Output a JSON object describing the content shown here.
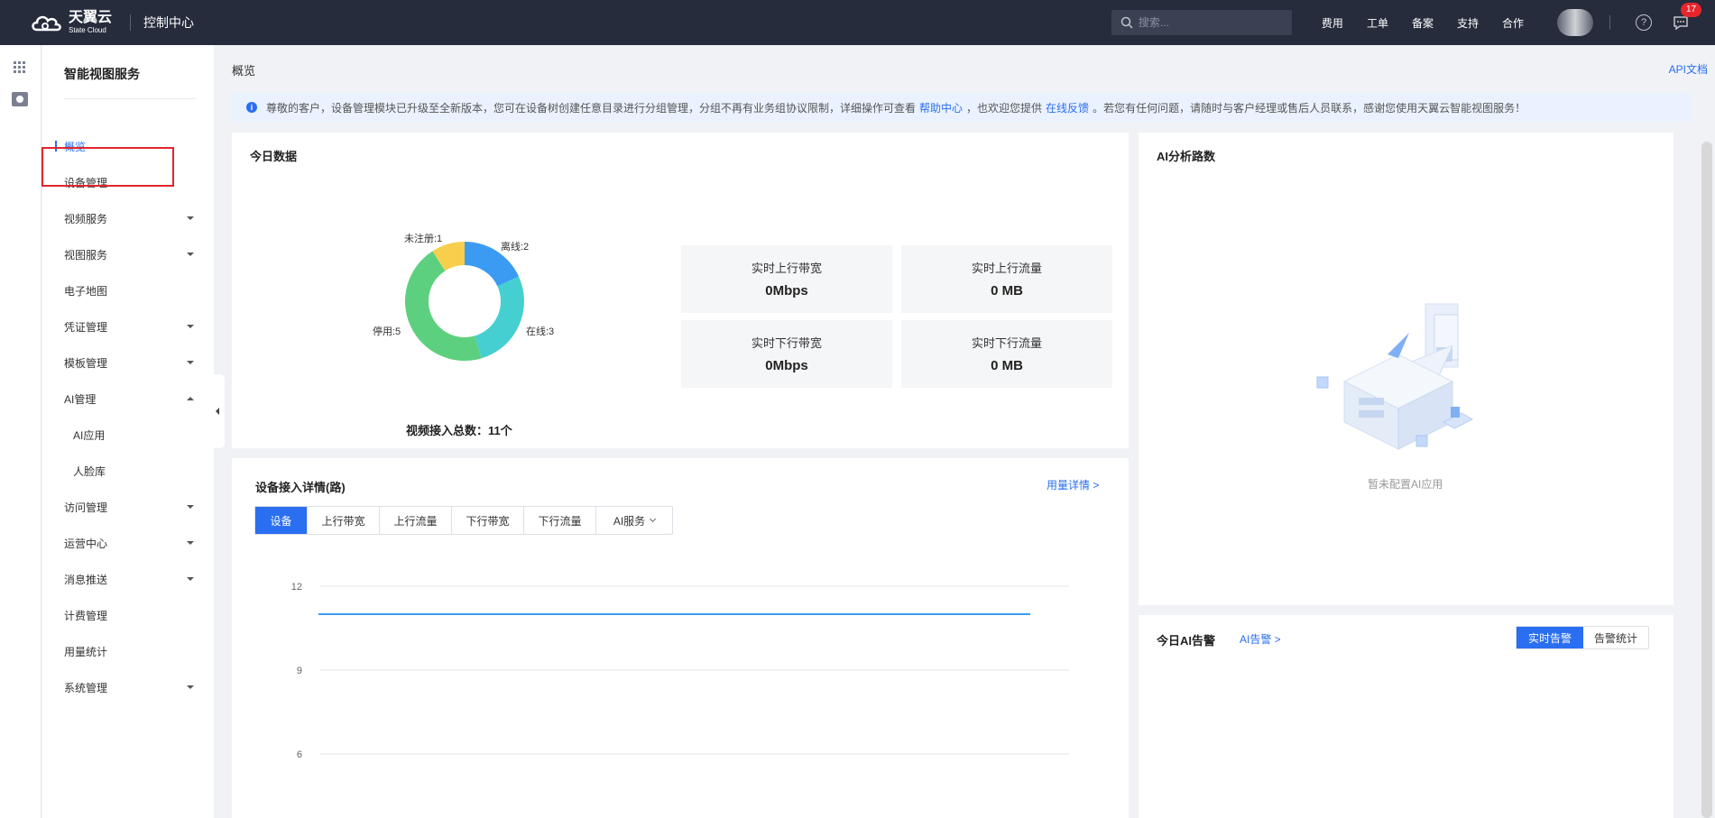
{
  "topbar": {
    "brand_cn": "天翼云",
    "brand_en": "State Cloud",
    "console": "控制中心",
    "search_placeholder": "搜索...",
    "links": [
      "费用",
      "工单",
      "备案",
      "支持",
      "合作"
    ],
    "help_glyph": "?",
    "message_count": "17"
  },
  "sidebar": {
    "title": "智能视图服务",
    "items": [
      {
        "label": "概览"
      },
      {
        "label": "设备管理"
      },
      {
        "label": "视频服务"
      },
      {
        "label": "视图服务"
      },
      {
        "label": "电子地图"
      },
      {
        "label": "凭证管理"
      },
      {
        "label": "模板管理"
      },
      {
        "label": "AI管理"
      },
      {
        "label": "AI应用"
      },
      {
        "label": "人脸库"
      },
      {
        "label": "访问管理"
      },
      {
        "label": "运营中心"
      },
      {
        "label": "消息推送"
      },
      {
        "label": "计费管理"
      },
      {
        "label": "用量统计"
      },
      {
        "label": "系统管理"
      }
    ]
  },
  "main": {
    "breadcrumb": "概览",
    "api_doc": "API文档",
    "notice": {
      "text1": "尊敬的客户，设备管理模块已升级至全新版本，您可在设备树创建任意目录进行分组管理，分组不再有业务组协议限制，详细操作可查看",
      "link1": "帮助中心",
      "text2": "，也欢迎您提供",
      "link2": "在线反馈",
      "text3": "。若您有任何问题，请随时与客户经理或售后人员联系，感谢您使用天翼云智能视图服务！"
    },
    "today": {
      "title": "今日数据",
      "pie_labels": [
        "未注册:1",
        "离线:2",
        "在线:3",
        "停用:5"
      ],
      "total": "视频接入总数：11个",
      "stats": [
        {
          "label": "实时上行带宽",
          "value": "0Mbps"
        },
        {
          "label": "实时上行流量",
          "value": "0 MB"
        },
        {
          "label": "实时下行带宽",
          "value": "0Mbps"
        },
        {
          "label": "实时下行流量",
          "value": "0 MB"
        }
      ]
    },
    "detail": {
      "title": "设备接入详情(路)",
      "usage_link": "用量详情 >",
      "tabs": [
        "设备",
        "上行带宽",
        "上行流量",
        "下行带宽",
        "下行流量",
        "AI服务"
      ]
    },
    "ai": {
      "title": "AI分析路数",
      "empty": "暂未配置AI应用"
    },
    "alerts": {
      "title": "今日AI告警",
      "link": "AI告警 >",
      "btn_realtime": "实时告警",
      "btn_stats": "告警统计"
    }
  },
  "chart_data": [
    {
      "type": "pie",
      "categories": [
        "未注册",
        "离线",
        "在线",
        "停用"
      ],
      "values": [
        1,
        2,
        3,
        5
      ],
      "colors": [
        "#f7cf4d",
        "#3b9bf3",
        "#46cfd0",
        "#5dd07f"
      ]
    },
    {
      "type": "line",
      "ytick_labels": [
        "12",
        "9",
        "6"
      ],
      "series": [
        {
          "values": [
            11,
            11
          ]
        }
      ],
      "color": "#3b9bf3"
    }
  ]
}
